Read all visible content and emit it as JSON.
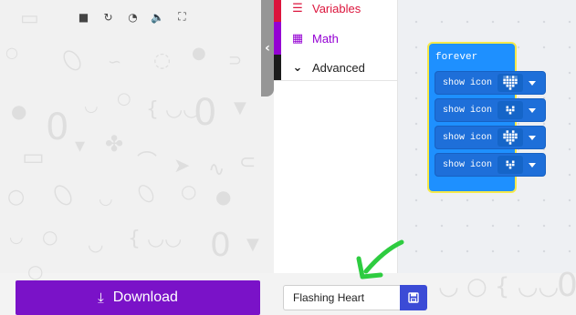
{
  "toolbox": {
    "items": [
      {
        "label": "Variables",
        "icon": "list-icon",
        "color": "#dc143c"
      },
      {
        "label": "Math",
        "icon": "calculator-icon",
        "color": "#9400d3"
      },
      {
        "label": "Advanced",
        "icon": "chevron-down-icon",
        "color": "#000000"
      }
    ],
    "colors": {
      "advanced_stripe": "#1b1b1b"
    }
  },
  "simulator": {
    "toolbar": [
      "stop-icon",
      "restart-icon",
      "slow-motion-icon",
      "sound-icon",
      "fullscreen-icon"
    ],
    "collapse_icon": "‹"
  },
  "workspace": {
    "forever_label": "forever",
    "blocks": [
      {
        "label": "show icon",
        "icon": "heart-icon"
      },
      {
        "label": "show icon",
        "icon": "small-heart-icon"
      },
      {
        "label": "show icon",
        "icon": "heart-icon"
      },
      {
        "label": "show icon",
        "icon": "small-heart-icon"
      }
    ],
    "colors": {
      "block": "#1e6fd9",
      "highlight": "#f5e94a"
    }
  },
  "bottom": {
    "download_label": "Download",
    "download_color": "#7a12c8",
    "project_name": "Flashing Heart",
    "save_icon": "save-icon"
  },
  "annotation": {
    "color": "#2ecc40",
    "icon": "green-arrow-icon"
  }
}
